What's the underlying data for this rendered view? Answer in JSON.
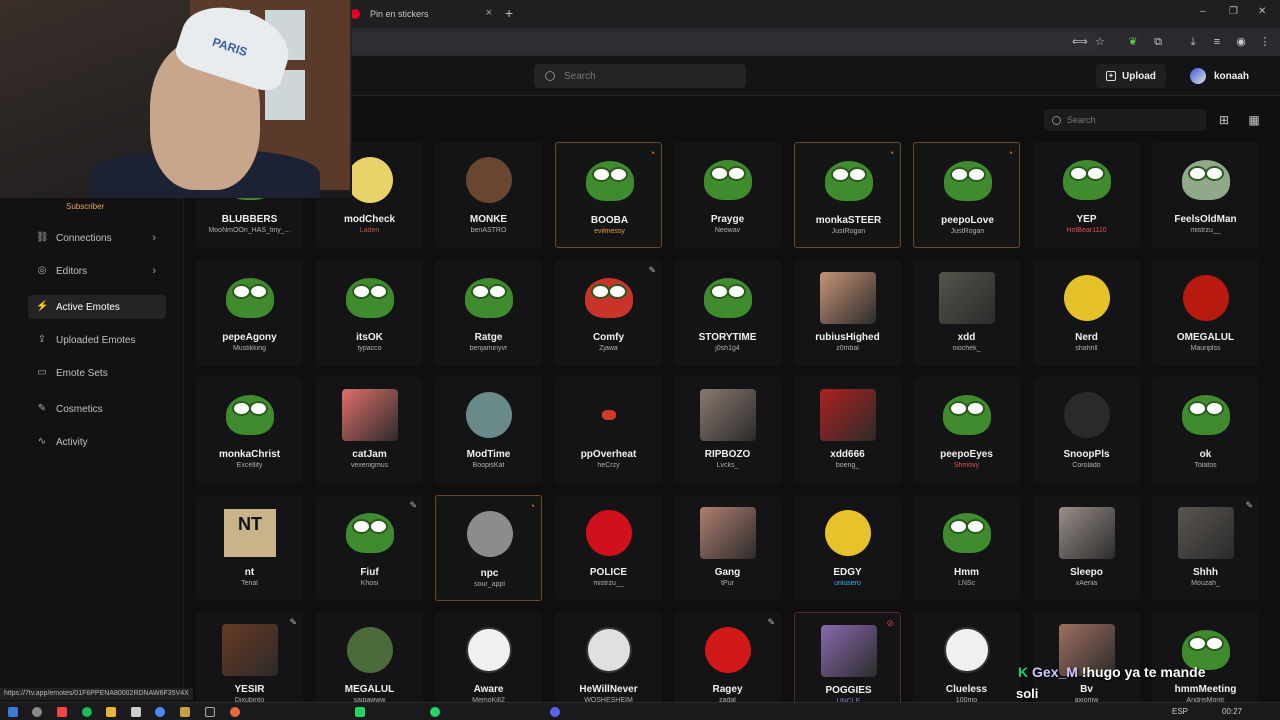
{
  "browser": {
    "tab_title": "Pin en stickers",
    "tab_close": "×",
    "new_tab": "+",
    "window_controls": [
      "–",
      "❐",
      "✕"
    ]
  },
  "header": {
    "search_placeholder": "Search",
    "upload_label": "Upload",
    "username": "konaah"
  },
  "sidebar": {
    "badge": "Subscriber",
    "items": [
      {
        "label": "Connections",
        "icon": "link-icon",
        "glyph": "⛓",
        "chevron": true
      },
      {
        "label": "Editors",
        "icon": "editors-icon",
        "glyph": "◎",
        "chevron": true
      },
      {
        "label": "Active Emotes",
        "icon": "bolt-icon",
        "glyph": "⚡",
        "chevron": false,
        "active": true
      },
      {
        "label": "Uploaded Emotes",
        "icon": "upload-icon",
        "glyph": "⇪",
        "chevron": false
      },
      {
        "label": "Emote Sets",
        "icon": "folder-icon",
        "glyph": "▭",
        "chevron": false
      },
      {
        "label": "Cosmetics",
        "icon": "brush-icon",
        "glyph": "✎",
        "chevron": false
      },
      {
        "label": "Activity",
        "icon": "activity-icon",
        "glyph": "∿",
        "chevron": false
      }
    ]
  },
  "content": {
    "search_placeholder": "Search"
  },
  "webcam": {
    "cap_text": "PARIS"
  },
  "emotes": [
    {
      "name": "BLUBBERS",
      "author": "MooNmOOn_HAS_tiny_...",
      "kind": "pepe",
      "color": "#3f8b2e",
      "author_color": "#b0b0b0"
    },
    {
      "name": "modCheck",
      "author": "Laden",
      "kind": "blob",
      "color": "#e8d36a",
      "author_color": "#c05050"
    },
    {
      "name": "MONKE",
      "author": "benASTRO",
      "kind": "blob",
      "color": "#6a4530",
      "author_color": "#b0b0b0"
    },
    {
      "name": "BOOBA",
      "author": "evilmessy",
      "kind": "pepe",
      "color": "#3f8b2e",
      "author_color": "#e0a040",
      "hl": "gold",
      "badge": "◔"
    },
    {
      "name": "Prayge",
      "author": "Neowav",
      "kind": "pepe",
      "color": "#3f8b2e",
      "author_color": "#b0b0b0"
    },
    {
      "name": "monkaSTEER",
      "author": "JustRogan",
      "kind": "pepe",
      "color": "#3f8b2e",
      "author_color": "#b0b0b0",
      "hl": "gold",
      "badge": "◔"
    },
    {
      "name": "peepoLove",
      "author": "JustRogan",
      "kind": "pepe",
      "color": "#3f8b2e",
      "author_color": "#b0b0b0",
      "hl": "gold",
      "badge": "◔"
    },
    {
      "name": "YEP",
      "author": "HotBear1110",
      "kind": "pepe",
      "color": "#3f8b2e",
      "author_color": "#e05050"
    },
    {
      "name": "FeelsOldMan",
      "author": "mistrzu__",
      "kind": "pepe",
      "color": "#8fa98a",
      "author_color": "#b0b0b0"
    },
    {
      "name": "pepeAgony",
      "author": "Mustikking",
      "kind": "pepe",
      "color": "#3f8b2e",
      "author_color": "#b0b0b0"
    },
    {
      "name": "itsOK",
      "author": "typacco",
      "kind": "pepe",
      "color": "#3f8b2e",
      "author_color": "#b0b0b0"
    },
    {
      "name": "Ratge",
      "author": "benjaminyvr",
      "kind": "pepe",
      "color": "#3f8b2e",
      "author_color": "#b0b0b0"
    },
    {
      "name": "Comfy",
      "author": "Zjawa",
      "kind": "pepe",
      "color": "#c8342a",
      "author_color": "#b0b0b0",
      "badge": "✎"
    },
    {
      "name": "STORYTIME",
      "author": "j0sh1g4",
      "kind": "pepe",
      "color": "#3f8b2e",
      "author_color": "#b0b0b0"
    },
    {
      "name": "rubiusHighed",
      "author": "z0mbal",
      "kind": "photo",
      "color": "#c89478",
      "author_color": "#b0b0b0"
    },
    {
      "name": "xdd",
      "author": "niochek_",
      "kind": "photo",
      "color": "#55554c",
      "author_color": "#b0b0b0"
    },
    {
      "name": "Nerd",
      "author": "shahrill",
      "kind": "blob",
      "color": "#e6c22a",
      "author_color": "#b0b0b0"
    },
    {
      "name": "OMEGALUL",
      "author": "Mauriplss",
      "kind": "blob",
      "color": "#b81a10",
      "author_color": "#b0b0b0"
    },
    {
      "name": "monkaChrist",
      "author": "Excellify",
      "kind": "pepe",
      "color": "#3f8b2e",
      "author_color": "#b0b0b0"
    },
    {
      "name": "catJam",
      "author": "vexenigmus",
      "kind": "photo",
      "color": "#e0706a",
      "author_color": "#b0b0b0"
    },
    {
      "name": "ModTime",
      "author": "BoopisKat",
      "kind": "blob",
      "color": "#6a8a8a",
      "author_color": "#b0b0b0"
    },
    {
      "name": "ppOverheat",
      "author": "heCrzy",
      "kind": "small",
      "color": "#d03a2a",
      "author_color": "#b0b0b0"
    },
    {
      "name": "RIPBOZO",
      "author": "Lvcks_",
      "kind": "photo",
      "color": "#8a7a70",
      "author_color": "#b0b0b0"
    },
    {
      "name": "xdd666",
      "author": "boeng_",
      "kind": "photo",
      "color": "#b02020",
      "author_color": "#b0b0b0"
    },
    {
      "name": "peepoEyes",
      "author": "Shmovy",
      "kind": "pepe",
      "color": "#3f8b2e",
      "author_color": "#e05050"
    },
    {
      "name": "SnoopPls",
      "author": "Corolado",
      "kind": "blob",
      "color": "#2a2a2a",
      "author_color": "#b0b0b0"
    },
    {
      "name": "ok",
      "author": "Tolatos",
      "kind": "pepe",
      "color": "#3f8b2e",
      "author_color": "#b0b0b0"
    },
    {
      "name": "nt",
      "author": "Tenal",
      "kind": "sign",
      "color": "#c9b48a",
      "author_color": "#b0b0b0"
    },
    {
      "name": "Fiuf",
      "author": "Khosi",
      "kind": "pepe",
      "color": "#3f8b2e",
      "author_color": "#b0b0b0",
      "badge": "✎"
    },
    {
      "name": "npc",
      "author": "sour_appl",
      "kind": "blob",
      "color": "#8c8c8c",
      "author_color": "#b0b0b0",
      "hl": "gold",
      "badge": "◔"
    },
    {
      "name": "POLICE",
      "author": "mistrzu__",
      "kind": "blob",
      "color": "#d0101a",
      "author_color": "#b0b0b0"
    },
    {
      "name": "Gang",
      "author": "tPur",
      "kind": "photo",
      "color": "#b08070",
      "author_color": "#b0b0b0"
    },
    {
      "name": "EDGY",
      "author": "uriiusero",
      "kind": "blob",
      "color": "#e8c22a",
      "author_color": "#40b0e0"
    },
    {
      "name": "Hmm",
      "author": "LNSc",
      "kind": "pepe",
      "color": "#3f8b2e",
      "author_color": "#b0b0b0"
    },
    {
      "name": "Sleepo",
      "author": "xAeriia",
      "kind": "photo",
      "color": "#9a8f8a",
      "author_color": "#b0b0b0"
    },
    {
      "name": "Shhh",
      "author": "Mouzah_",
      "kind": "photo",
      "color": "#5a5550",
      "author_color": "#b0b0b0",
      "badge": "✎"
    },
    {
      "name": "YESIR",
      "author": "Dixubinto",
      "kind": "photo",
      "color": "#6a3a22",
      "author_color": "#b0b0b0",
      "badge": "✎"
    },
    {
      "name": "MEGALUL",
      "author": "saipawww",
      "kind": "blob",
      "color": "#4a6a3a",
      "author_color": "#b0b0b0"
    },
    {
      "name": "Aware",
      "author": "MemoKill2",
      "kind": "face",
      "color": "#f0f0f0",
      "author_color": "#b0b0b0"
    },
    {
      "name": "HeWillNever",
      "author": "WOSHESHEIM",
      "kind": "face",
      "color": "#e0e0e0",
      "author_color": "#b0b0b0"
    },
    {
      "name": "Ragey",
      "author": "zadal",
      "kind": "blob",
      "color": "#d01818",
      "author_color": "#b0b0b0",
      "badge": "✎"
    },
    {
      "name": "POGGIES",
      "author": "UNCLE",
      "kind": "photo",
      "color": "#8a6ab0",
      "author_color": "#9070c0",
      "hl": "red",
      "badge": "⊘"
    },
    {
      "name": "Clueless",
      "author": "100mo",
      "kind": "face",
      "color": "#f0f0f0",
      "author_color": "#b0b0b0"
    },
    {
      "name": "Bv",
      "author": "axiomw",
      "kind": "photo",
      "color": "#a07060",
      "author_color": "#b0b0b0"
    },
    {
      "name": "hmmMeeting",
      "author": "AndreiMontr",
      "kind": "pepe",
      "color": "#3f8b2e",
      "author_color": "#b0b0b0"
    }
  ],
  "status_url": "https://7tv.app/emotes/01F6PPENA80002RDNAW6F35V4X",
  "chat_overlay": {
    "badge": "K",
    "name": "Gex_M",
    "message": "!hugo ya te mande",
    "line2": "soli"
  },
  "taskbar": {
    "lang": "ESP",
    "time": "00:27"
  }
}
